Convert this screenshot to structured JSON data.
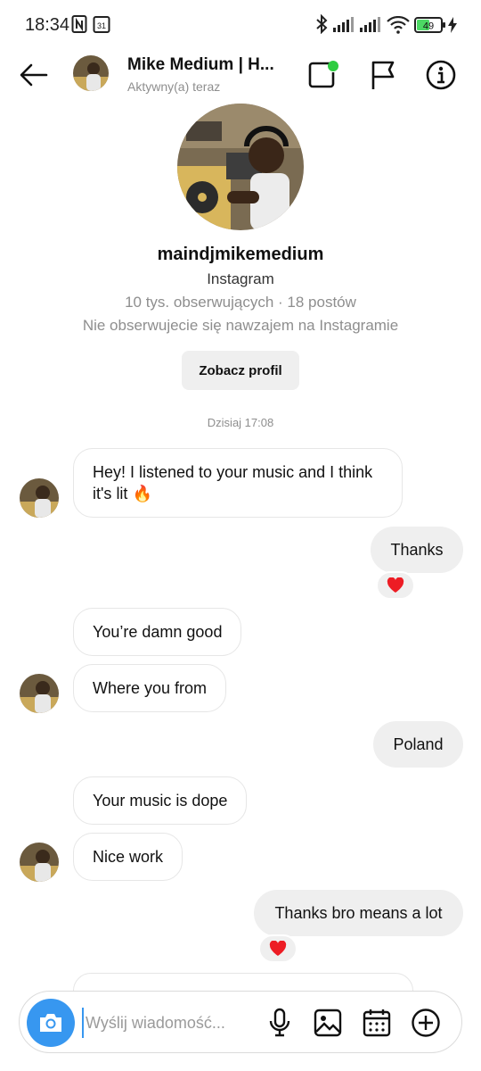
{
  "status_bar": {
    "time": "18:34",
    "calendar_day": "31",
    "battery": "49"
  },
  "header": {
    "name": "Mike Medium | H...",
    "status": "Aktywny(a) teraz"
  },
  "profile": {
    "username": "maindjmikemedium",
    "platform": "Instagram",
    "stats": "10 tys. obserwujących · 18 postów",
    "mutual": "Nie obserwujecie się nawzajem na Instagramie",
    "view_profile_label": "Zobacz profil"
  },
  "date_separator": "Dzisiaj 17:08",
  "messages": [
    {
      "from": "them",
      "text_line1": "Hey! I listened to your music and I think",
      "text_line2": "it's  lit 🔥"
    },
    {
      "from": "me",
      "text": "Thanks",
      "reaction": "❤️"
    },
    {
      "from": "them",
      "text": "You’re damn good"
    },
    {
      "from": "them",
      "text": "Where you from"
    },
    {
      "from": "me",
      "text": "Poland"
    },
    {
      "from": "them",
      "text": "Your music is dope"
    },
    {
      "from": "them",
      "text": "Nice work"
    },
    {
      "from": "me",
      "text": "Thanks bro means a lot",
      "reaction": "❤️"
    }
  ],
  "composer": {
    "placeholder": "Wyślij wiadomość..."
  },
  "colors": {
    "accent": "#3797f0",
    "online": "#2ecc40",
    "heart": "#ed1c24"
  }
}
